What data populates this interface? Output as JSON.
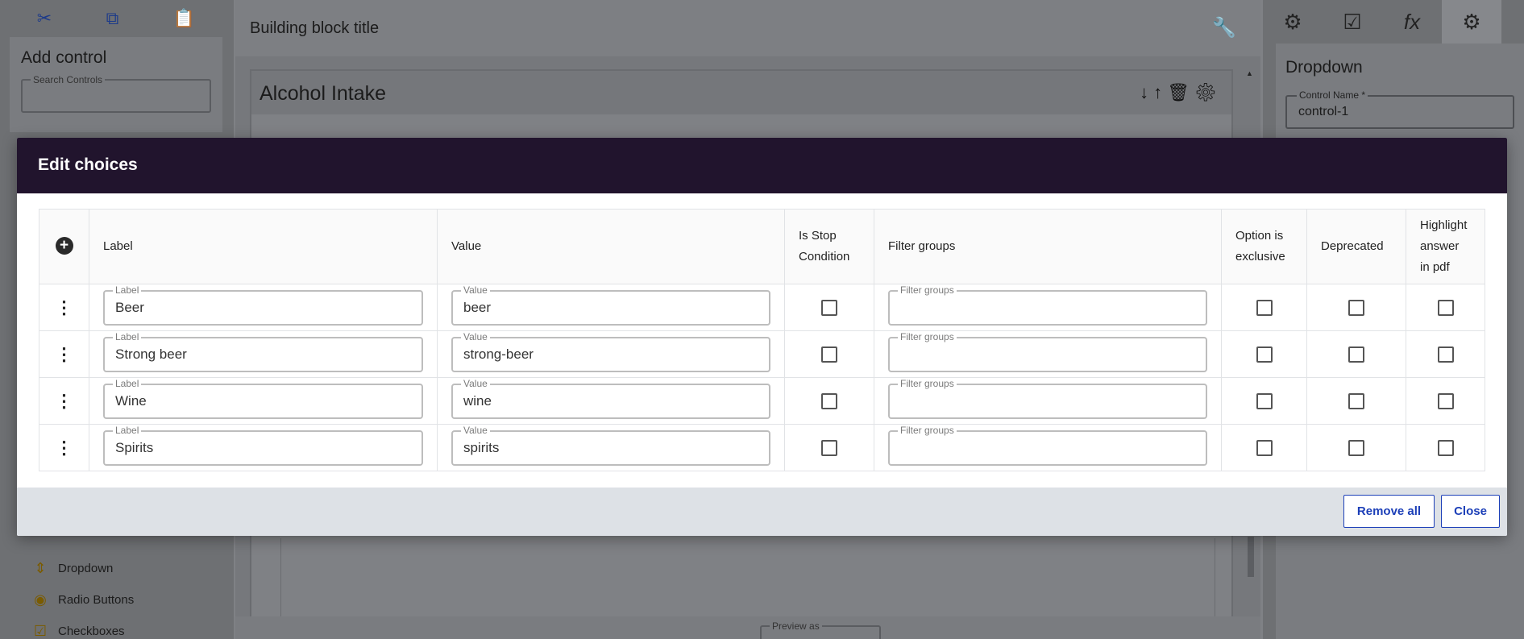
{
  "left_panel": {
    "add_control_title": "Add control",
    "search_label": "Search Controls",
    "controls": [
      {
        "label": "Dropdown",
        "icon": "dropdown-icon"
      },
      {
        "label": "Radio Buttons",
        "icon": "radio-buttons-icon"
      },
      {
        "label": "Checkboxes",
        "icon": "checkboxes-icon"
      }
    ]
  },
  "center_panel": {
    "block_title": "Building block title",
    "section_title": "Alcohol Intake",
    "preview_label": "Preview as"
  },
  "right_panel": {
    "title": "Dropdown",
    "control_name_label": "Control Name *",
    "control_name_value": "control-1"
  },
  "modal": {
    "title": "Edit choices",
    "columns": {
      "label": "Label",
      "value": "Value",
      "stop": "Is Stop Condition",
      "filter": "Filter groups",
      "exclusive": "Option is exclusive",
      "deprecated": "Deprecated",
      "highlight": "Highlight answer in pdf"
    },
    "field_labels": {
      "label": "Label",
      "value": "Value",
      "filter": "Filter groups"
    },
    "rows": [
      {
        "label": "Beer",
        "value": "beer"
      },
      {
        "label": "Strong beer",
        "value": "strong-beer"
      },
      {
        "label": "Wine",
        "value": "wine"
      },
      {
        "label": "Spirits",
        "value": "spirits"
      }
    ],
    "remove_all_label": "Remove all",
    "close_label": "Close"
  }
}
